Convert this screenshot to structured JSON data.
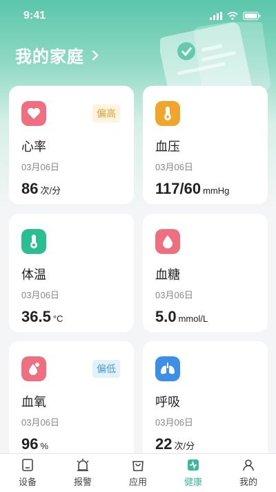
{
  "status": {
    "time": "9:41"
  },
  "header": {
    "title": "我的家庭"
  },
  "colors": {
    "accent": "#3cb89a",
    "heart": "#ef6f80",
    "pressure": "#f1a52c",
    "temp": "#2bbd93",
    "sugar": "#ef6f80",
    "oxygen": "#ef6f80",
    "breath": "#3b8fe6"
  },
  "cards": [
    {
      "title": "心率",
      "date": "03月06日",
      "value": "86",
      "unit": "次/分",
      "badge": "偏高",
      "icon": "heart-icon"
    },
    {
      "title": "血压",
      "date": "03月06日",
      "value": "117/60",
      "unit": "mmHg",
      "badge": "",
      "icon": "thermometer-icon"
    },
    {
      "title": "体温",
      "date": "03月06日",
      "value": "36.5",
      "unit": "°C",
      "badge": "",
      "icon": "thermometer-icon"
    },
    {
      "title": "血糖",
      "date": "03月06日",
      "value": "5.0",
      "unit": "mmol/L",
      "badge": "",
      "icon": "drop-icon"
    },
    {
      "title": "血氧",
      "date": "03月06日",
      "value": "96",
      "unit": "%",
      "badge": "偏低",
      "icon": "oxygen-drop-icon"
    },
    {
      "title": "呼吸",
      "date": "03月06日",
      "value": "22",
      "unit": "次/分",
      "badge": "",
      "icon": "lungs-icon"
    }
  ],
  "tabs": [
    {
      "label": "设备",
      "icon": "device-icon"
    },
    {
      "label": "报警",
      "icon": "alarm-icon"
    },
    {
      "label": "应用",
      "icon": "app-bag-icon"
    },
    {
      "label": "健康",
      "icon": "health-icon"
    },
    {
      "label": "我的",
      "icon": "profile-icon"
    }
  ]
}
